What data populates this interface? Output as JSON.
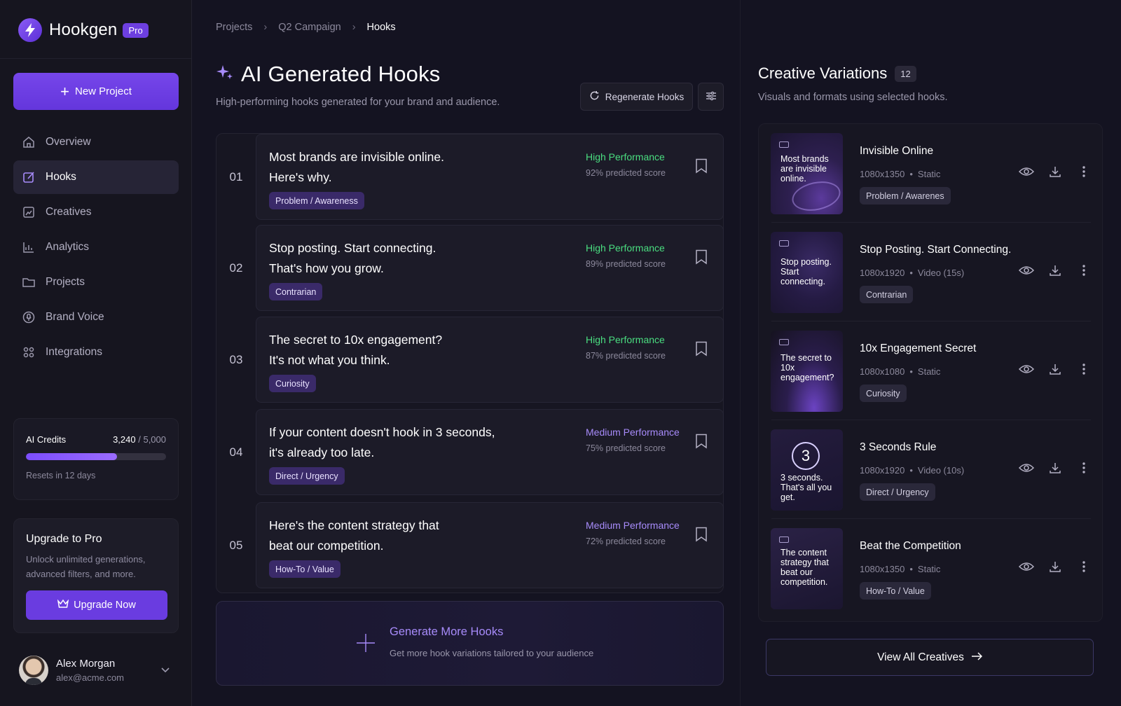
{
  "brand": {
    "name": "Hookgen",
    "badge": "Pro"
  },
  "sidebar": {
    "new_project_label": "New Project",
    "items": [
      {
        "label": "Overview",
        "icon": "home-icon",
        "active": false
      },
      {
        "label": "Hooks",
        "icon": "edit-icon",
        "active": true
      },
      {
        "label": "Creatives",
        "icon": "image-icon",
        "active": false
      },
      {
        "label": "Analytics",
        "icon": "chart-icon",
        "active": false
      },
      {
        "label": "Projects",
        "icon": "folder-icon",
        "active": false
      },
      {
        "label": "Brand Voice",
        "icon": "voice-icon",
        "active": false
      },
      {
        "label": "Integrations",
        "icon": "integrations-icon",
        "active": false
      }
    ],
    "credits": {
      "title": "AI Credits",
      "used": "3,240",
      "total": "/ 5,000",
      "fraction": 0.648,
      "reset": "Resets in 12 days"
    },
    "upgrade": {
      "title": "Upgrade to Pro",
      "text_line1": "Unlock unlimited generations,",
      "text_line2": "advanced filters, and more.",
      "button": "Upgrade Now"
    },
    "user": {
      "name": "Alex Morgan",
      "email": "alex@acme.com"
    }
  },
  "breadcrumb": {
    "items": [
      "Projects",
      "Q2 Campaign"
    ],
    "current": "Hooks"
  },
  "main": {
    "title": "AI Generated Hooks",
    "subtitle": "High-performing hooks generated for your brand and audience.",
    "regenerate_label": "Regenerate Hooks",
    "hooks": [
      {
        "num": "01",
        "line1": "Most brands are invisible online.",
        "line2": "Here's why.",
        "tag": "Problem / Awareness",
        "performance": "High Performance",
        "level": "high",
        "score": "92% predicted score"
      },
      {
        "num": "02",
        "line1": "Stop posting. Start connecting.",
        "line2": "That's how you grow.",
        "tag": "Contrarian",
        "performance": "High Performance",
        "level": "high",
        "score": "89% predicted score"
      },
      {
        "num": "03",
        "line1": "The secret to 10x engagement?",
        "line2": "It's not what you think.",
        "tag": "Curiosity",
        "performance": "High Performance",
        "level": "high",
        "score": "87% predicted score"
      },
      {
        "num": "04",
        "line1": "If your content doesn't hook in 3 seconds,",
        "line2": "it's already too late.",
        "tag": "Direct / Urgency",
        "performance": "Medium Performance",
        "level": "medium",
        "score": "75% predicted score"
      },
      {
        "num": "05",
        "line1": "Here's the content strategy that",
        "line2": "beat our competition.",
        "tag": "How-To / Value",
        "performance": "Medium Performance",
        "level": "medium",
        "score": "72% predicted score"
      }
    ],
    "generate_more": {
      "title": "Generate More Hooks",
      "subtitle": "Get more hook variations tailored to your audience"
    }
  },
  "creatives": {
    "title": "Creative Variations",
    "count": "12",
    "subtitle": "Visuals and formats using selected hooks.",
    "items": [
      {
        "title": "Invisible Online",
        "size": "1080x1350",
        "format": "Static",
        "tag": "Problem / Awarenes",
        "thumb_text": "Most brands are invisible online."
      },
      {
        "title": "Stop Posting. Start Connecting.",
        "size": "1080x1920",
        "format": "Video (15s)",
        "tag": "Contrarian",
        "thumb_text": "Stop posting. Start connecting."
      },
      {
        "title": "10x Engagement Secret",
        "size": "1080x1080",
        "format": "Static",
        "tag": "Curiosity",
        "thumb_text": "The secret to 10x engagement?"
      },
      {
        "title": "3 Seconds Rule",
        "size": "1080x1920",
        "format": "Video (10s)",
        "tag": "Direct / Urgency",
        "thumb_text": "3 seconds. That's all you get.",
        "thumb_big": "3"
      },
      {
        "title": "Beat the Competition",
        "size": "1080x1350",
        "format": "Static",
        "tag": "How-To / Value",
        "thumb_text": "The content strategy that beat our competition."
      }
    ],
    "view_all_label": "View All Creatives"
  },
  "colors": {
    "accent": "#7646ea",
    "high": "#4ade80",
    "medium": "#a78bfa",
    "background": "#141321"
  }
}
